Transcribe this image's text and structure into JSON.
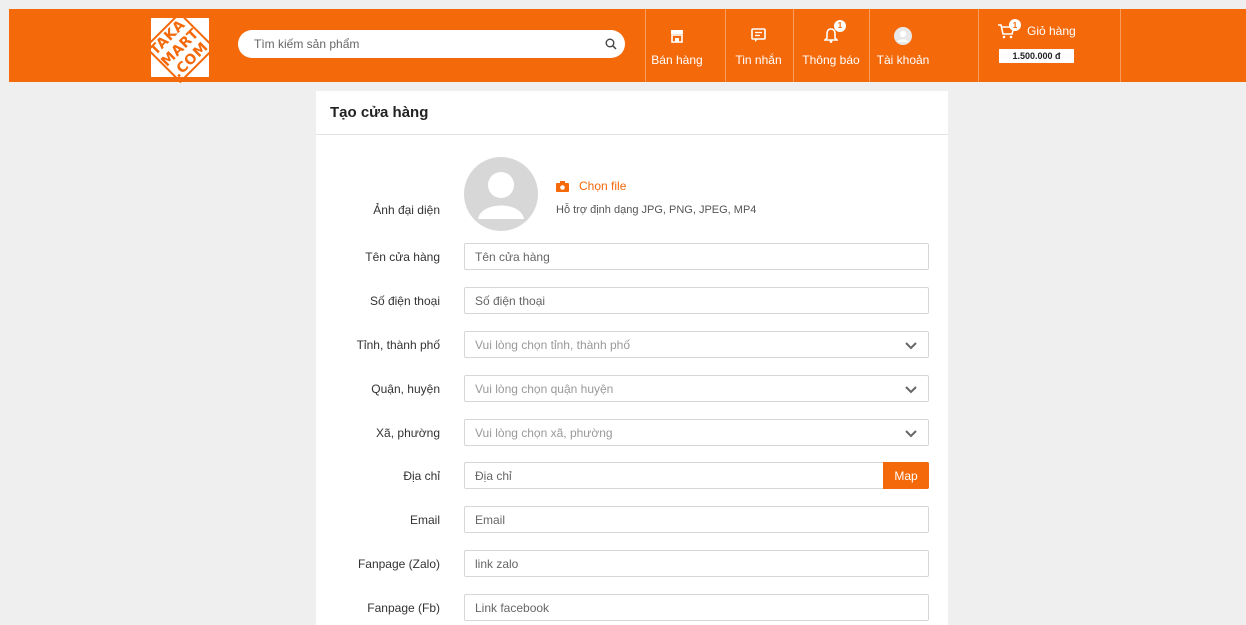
{
  "colors": {
    "brand": "#f4690a"
  },
  "header": {
    "logo_text": "TAKA MART .COM",
    "search": {
      "placeholder": "Tìm kiếm sản phẩm",
      "icon": "search-icon"
    },
    "nav": [
      {
        "label": "Bán hàng",
        "icon": "store-icon"
      },
      {
        "label": "Tin nhắn",
        "icon": "message-icon"
      },
      {
        "label": "Thông báo",
        "icon": "bell-icon",
        "badge": "1"
      },
      {
        "label": "Tài khoản",
        "icon": "user-icon"
      }
    ],
    "cart": {
      "label": "Giỏ hàng",
      "badge": "1",
      "total": "1.500.000 đ",
      "icon": "cart-icon"
    }
  },
  "panel": {
    "title": "Tạo cửa hàng",
    "avatar": {
      "label": "Ảnh đại diện",
      "choose_file": "Chọn file",
      "hint": "Hỗ trợ định dạng JPG, PNG, JPEG, MP4"
    },
    "fields": [
      {
        "label": "Tên cửa hàng",
        "placeholder": "Tên cửa hàng",
        "type": "input"
      },
      {
        "label": "Số điện thoại",
        "placeholder": "Số điện thoại",
        "type": "input"
      },
      {
        "label": "Tỉnh, thành phố",
        "placeholder": "Vui lòng chọn tỉnh, thành phố",
        "type": "select"
      },
      {
        "label": "Quận, huyện",
        "placeholder": "Vui lòng chọn quận huyện",
        "type": "select"
      },
      {
        "label": "Xã, phường",
        "placeholder": "Vui lòng chọn xã, phường",
        "type": "select"
      },
      {
        "label": "Địa chỉ",
        "placeholder": "Địa chỉ",
        "type": "input",
        "button": "Map"
      },
      {
        "label": "Email",
        "placeholder": "Email",
        "type": "input"
      },
      {
        "label": "Fanpage (Zalo)",
        "placeholder": "link zalo",
        "type": "input"
      },
      {
        "label": "Fanpage (Fb)",
        "placeholder": "Link facebook",
        "type": "input"
      }
    ]
  }
}
